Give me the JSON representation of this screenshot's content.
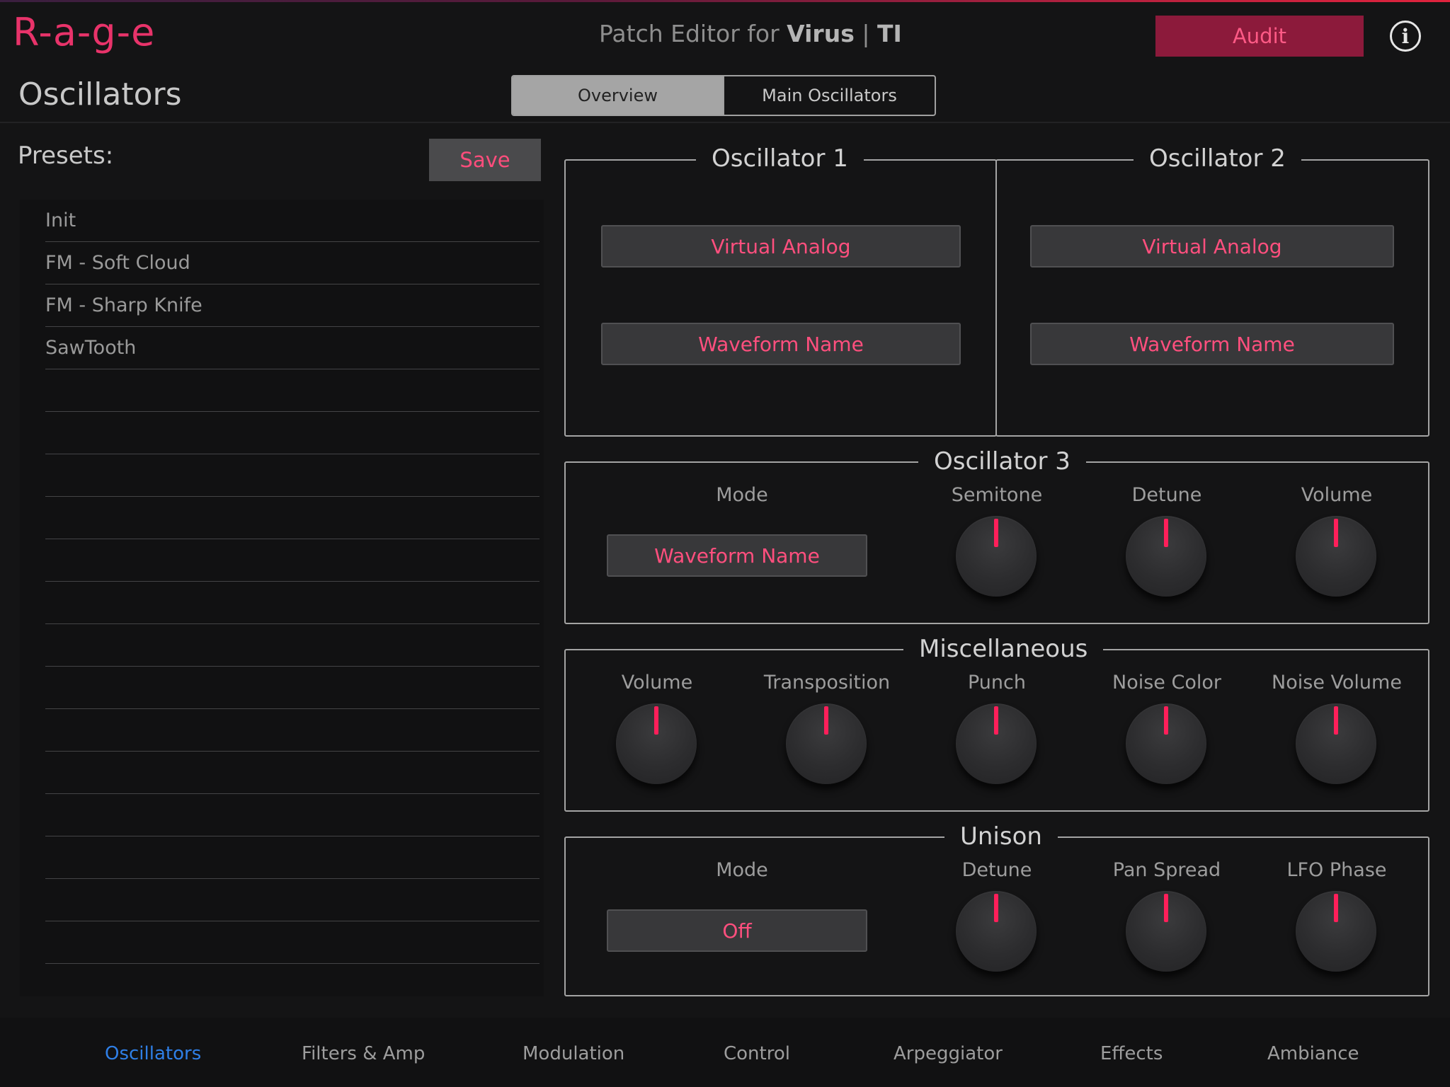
{
  "app": {
    "logo": "R-a-g-e",
    "title_prefix": "Patch Editor for ",
    "title_brand": "Virus",
    "title_sep": " | ",
    "title_model": "TI",
    "audit_label": "Audit",
    "info_glyph": "i"
  },
  "page": {
    "title": "Oscillators",
    "segments": [
      "Overview",
      "Main Oscillators"
    ],
    "active_segment": "Overview"
  },
  "presets": {
    "label": "Presets:",
    "save_label": "Save",
    "items": [
      "Init",
      "FM - Soft Cloud",
      "FM - Sharp Knife",
      "SawTooth",
      "",
      "",
      "",
      "",
      "",
      "",
      "",
      "",
      "",
      "",
      "",
      "",
      "",
      ""
    ]
  },
  "osc1": {
    "title": "Oscillator 1",
    "model": "Virtual Analog",
    "waveform": "Waveform Name"
  },
  "osc2": {
    "title": "Oscillator 2",
    "model": "Virtual Analog",
    "waveform": "Waveform Name"
  },
  "osc3": {
    "title": "Oscillator 3",
    "mode_label": "Mode",
    "mode_value": "Waveform Name",
    "semitone_label": "Semitone",
    "detune_label": "Detune",
    "volume_label": "Volume"
  },
  "misc": {
    "title": "Miscellaneous",
    "volume_label": "Volume",
    "transposition_label": "Transposition",
    "punch_label": "Punch",
    "noise_color_label": "Noise Color",
    "noise_volume_label": "Noise Volume"
  },
  "unison": {
    "title": "Unison",
    "mode_label": "Mode",
    "mode_value": "Off",
    "detune_label": "Detune",
    "pan_spread_label": "Pan Spread",
    "lfo_phase_label": "LFO Phase"
  },
  "tabs": [
    "Oscillators",
    "Filters & Amp",
    "Modulation",
    "Control",
    "Arpeggiator",
    "Effects",
    "Ambiance"
  ],
  "active_tab": "Oscillators",
  "colors": {
    "accent": "#ff4f7e",
    "knob_pointer": "#ff1f5a",
    "audit_bg": "#8c1a3b",
    "active_tab": "#2f7fe6"
  }
}
